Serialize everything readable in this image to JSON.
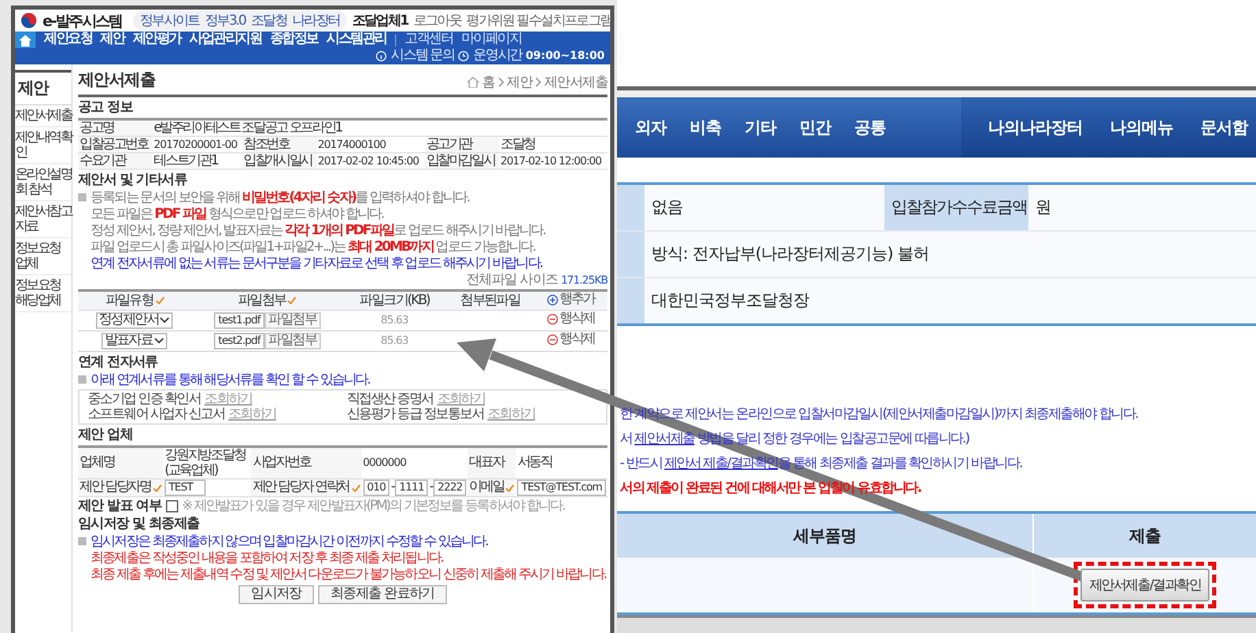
{
  "left_screen": {
    "header": {
      "logo": "e-발주시스템",
      "quick_links": [
        "정부사이트",
        "정부3.0",
        "조달청",
        "나라장터"
      ],
      "user_links": [
        "조달업체1",
        "로그아웃",
        "평가위원 필수설치프로그램"
      ]
    },
    "nav": {
      "menu": [
        "제안요청",
        "제안",
        "제안평가",
        "사업관리지원",
        "종합정보",
        "시스템관리"
      ],
      "extra": [
        "고객센터",
        "마이페이지"
      ],
      "help": "시스템 문의",
      "hours_label": "운영시간",
      "hours": "09:00~18:00"
    },
    "sidebar": {
      "title": "제안",
      "items": [
        "제안서제출",
        "제안내역확인",
        "온라인설명회 참석",
        "제안서참고자료",
        "정보요청 업체",
        "정보요청 해당업체"
      ]
    },
    "page_title": "제안서제출",
    "breadcrumb": [
      "홈",
      "제안",
      "제안서제출"
    ],
    "notice_info": {
      "title": "공고 정보",
      "rows": [
        {
          "fields": [
            {
              "label": "공고명",
              "value": "e발주리아테스트 조달공고 오프라인1"
            }
          ]
        },
        {
          "fields": [
            {
              "label": "입찰공고번호",
              "value": "20170200001-00"
            },
            {
              "label": "참조번호",
              "value": "20174000100"
            },
            {
              "label": "공고기관",
              "value": "조달청"
            }
          ]
        },
        {
          "fields": [
            {
              "label": "수요기관",
              "value": "테스트기관1"
            },
            {
              "label": "입찰개시일시",
              "value": "2017-02-02 10:45:00"
            },
            {
              "label": "입찰마감일시",
              "value": "2017-02-10 12:00:00"
            }
          ]
        }
      ]
    },
    "documents": {
      "title": "제안서 및 기타서류",
      "notes": [
        {
          "kind": "normal",
          "text": "등록되는 문서의 보안을 위해 **비밀번호(4자리 숫자)**를 입력하셔야 합니다."
        },
        {
          "kind": "normal",
          "text": "모든 파일은 **PDF 파일** 형식으로만 업로드 하셔야 합니다."
        },
        {
          "kind": "normal",
          "text": "정성 제안서, 정량 제안서, 발표자료는 **각각 1개의 PDF파일**로 업로드 해주시기 바랍니다."
        },
        {
          "kind": "normal",
          "text": "파일 업로드시 총 파일사이즈(파일1+파일2+...)는 **최대 20MB까지** 업로드 가능합니다."
        },
        {
          "kind": "info",
          "text": "연계 전자서류에 없는 서류는 문서구분을 기타자료로 선택 후 업로드 해주시기 바랍니다."
        }
      ],
      "total_label": "전체파일 사이즈",
      "total": "171.25KB",
      "columns": [
        {
          "label": "파일유형",
          "required": true
        },
        {
          "label": "파일첨부",
          "required": true
        },
        {
          "label": "파일크기(KB)",
          "required": false
        },
        {
          "label": "첨부된파일",
          "required": false
        }
      ],
      "add_row": "행추가",
      "rows": [
        {
          "type": "정성제안서",
          "file": "test1.pdf",
          "attach": "파일첨부",
          "size": "85.63",
          "delete": "행삭제"
        },
        {
          "type": "발표자료",
          "file": "test2.pdf",
          "attach": "파일첨부",
          "size": "85.63",
          "delete": "행삭제"
        }
      ]
    },
    "linked": {
      "title": "연계 전자서류",
      "note": "아래 연계서류를 통해 해당서류를 확인 할 수 있습니다.",
      "items": [
        {
          "label": "중소기업 인증 확인서",
          "action": "조회하기"
        },
        {
          "label": "직접생산 증명서",
          "action": "조회하기"
        },
        {
          "label": "소프트웨어 사업자 신고서",
          "action": "조회하기"
        },
        {
          "label": "신용평가 등급 정보통보서",
          "action": "조회하기"
        }
      ]
    },
    "company": {
      "title": "제안 업체",
      "rows": [
        {
          "fields": [
            {
              "label": "업체명",
              "required": false,
              "kind": "text",
              "value": "강원지방조달청(교육업체)"
            },
            {
              "label": "사업자번호",
              "required": false,
              "kind": "text",
              "value": "0000000"
            },
            {
              "label": "대표자",
              "required": false,
              "kind": "text",
              "value": "서동직"
            }
          ]
        },
        {
          "fields": [
            {
              "label": "제안 담당자명",
              "required": true,
              "kind": "input",
              "value": "TEST"
            },
            {
              "label": "제안 담당자 연락처",
              "required": true,
              "kind": "phone",
              "parts": [
                "010",
                "1111",
                "2222"
              ],
              "separator": "-"
            },
            {
              "label": "이메일",
              "required": true,
              "kind": "input",
              "value": "TEST@TEST.com"
            }
          ]
        }
      ]
    },
    "presentation": {
      "label": "제안 발표 여부",
      "checked": false,
      "note": "※ 제안발표가 있을 경우 제안발표자(PM)의 기본정보를 등록하셔야 합니다."
    },
    "submit": {
      "title": "임시저장 및 최종제출",
      "notes": [
        {
          "kind": "info",
          "text": "임시저장은 최종제출하지 않으며 입찰마감시간 이전까지 수정할 수 있습니다."
        },
        {
          "kind": "warning",
          "text": "최종제출은 작성중인 내용을 포함하여 저장 후 최종 제출 처리됩니다."
        },
        {
          "kind": "warning",
          "text": "최종 제출 후에는 제출내역 수정 및 제안서 다운로드가 불가능하오니 신중히 제출해 주시기 바랍니다."
        }
      ],
      "buttons": [
        "임시저장",
        "최종제출 완료하기"
      ]
    }
  },
  "right_screen": {
    "nav": {
      "menu": [
        "외자",
        "비축",
        "기타",
        "민간",
        "공통"
      ],
      "right_menu": [
        "나의나라장터",
        "나의메뉴",
        "문서함"
      ]
    },
    "info_rows": [
      {
        "cells": [
          {
            "kind": "value",
            "text": "없음"
          },
          {
            "kind": "label",
            "text": "입찰참가수수료금액"
          },
          {
            "kind": "value",
            "text": "원"
          }
        ]
      },
      {
        "cells": [
          {
            "kind": "value",
            "text": "방식: 전자납부(나라장터제공기능) 불허"
          }
        ]
      },
      {
        "cells": [
          {
            "kind": "value",
            "text": "대한민국정부조달청장"
          }
        ]
      }
    ],
    "notices": [
      {
        "kind": "info",
        "parts": [
          {
            "text": "한 계약으로 제안서는 온라인으로 입찰서마감일시(제안서제출마감일시)까지 최종제출해야 합니다.",
            "link": false
          }
        ]
      },
      {
        "kind": "info",
        "parts": [
          {
            "text": "서 ",
            "link": false
          },
          {
            "text": "제안서제출",
            "link": true
          },
          {
            "text": " 방법을 달리 정한 경우에는 입찰공고문에 따릅니다.)",
            "link": false
          }
        ]
      },
      {
        "kind": "info",
        "parts": [
          {
            "text": "- 반드시 ",
            "link": false
          },
          {
            "text": "제안서 제출/결과확인",
            "link": true
          },
          {
            "text": "을 통해 최종제출 결과를 확인하시기 바랍니다.",
            "link": false
          }
        ]
      },
      {
        "kind": "warning",
        "parts": [
          {
            "text": "서의 제출이 완료된 건에 대해서만 본 입찰이 유효합니다.",
            "link": false
          }
        ]
      }
    ],
    "table": {
      "columns": [
        "세부품명",
        "제출"
      ],
      "button": "제안서제출/결과확인",
      "highlighted": true
    }
  }
}
